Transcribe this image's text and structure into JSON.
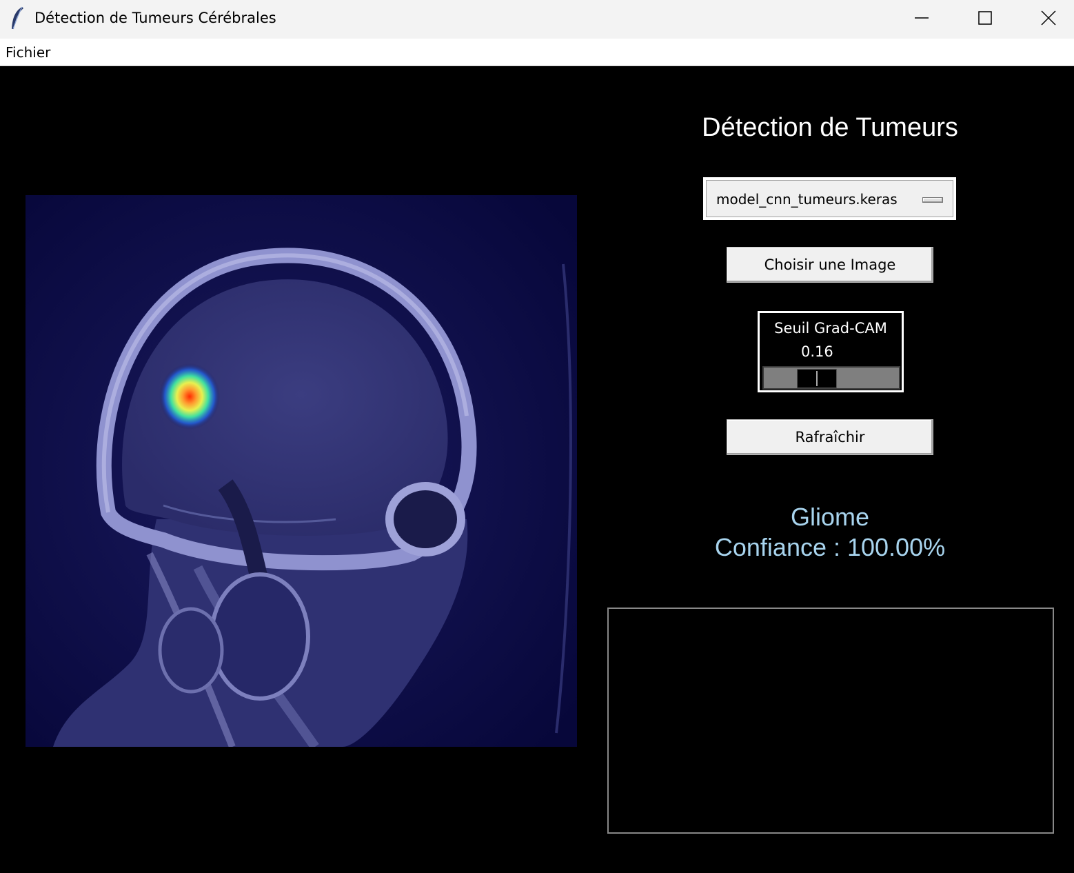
{
  "window": {
    "title": "Détection de Tumeurs Cérébrales",
    "icon": "feather-icon"
  },
  "menubar": {
    "items": [
      {
        "label": "Fichier"
      }
    ]
  },
  "image_panel": {
    "description_icon": "mri-scan-image"
  },
  "panel": {
    "title": "Détection de Tumeurs",
    "model_select": {
      "value": "model_cnn_tumeurs.keras"
    },
    "choose_button": "Choisir une Image",
    "threshold": {
      "label": "Seuil Grad-CAM",
      "value_text": "0.16",
      "value": 0.16
    },
    "refresh_button": "Rafraîchir",
    "result": {
      "class": "Gliome",
      "confidence": "Confiance : 100.00%"
    }
  },
  "colors": {
    "background": "#000000",
    "result_text": "#a8d4ee",
    "mri_tint": "#0a0a45"
  }
}
